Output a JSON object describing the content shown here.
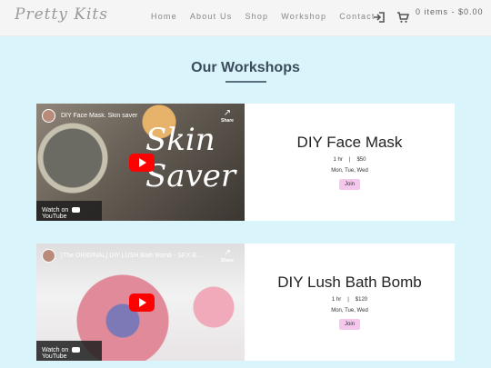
{
  "header": {
    "logo": "Pretty Kits",
    "nav": [
      "Home",
      "About Us",
      "Shop",
      "Workshop",
      "Contact"
    ],
    "icons": [
      "login-icon",
      "cart-icon"
    ],
    "cart": "0 items - $0.00"
  },
  "main": {
    "title": "Our Workshops",
    "workshops": [
      {
        "video_title": "DIY Face Mask. Skin saver",
        "share_label": "Share",
        "overlay": "Skin Saver",
        "watch_label": "Watch on",
        "yt_label": "YouTube",
        "name": "DIY Face Mask",
        "duration": "1 hr",
        "price": "$50",
        "days": "Mon, Tue, Wed",
        "join": "Join"
      },
      {
        "video_title": "[The ORIGINAL] DIY LUSH Bath Bomb - SEX BOM...",
        "share_label": "Share",
        "overlay": "",
        "watch_label": "Watch on",
        "yt_label": "YouTube",
        "name": "DIY Lush Bath Bomb",
        "duration": "1 hr",
        "price": "$120",
        "days": "Mon, Tue, Wed",
        "join": "Join"
      }
    ]
  },
  "colors": {
    "background": "#d9f4fb",
    "join_button": "#f4c8ec",
    "play_button": "#ff0000"
  }
}
